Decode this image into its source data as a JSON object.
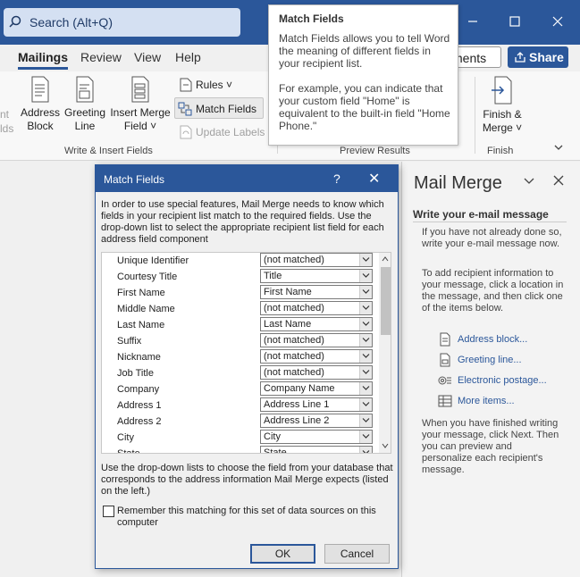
{
  "titlebar": {
    "search_placeholder": "Search (Alt+Q)",
    "minimize": "minimize",
    "maximize": "maximize",
    "close": "close"
  },
  "tabs": [
    {
      "label": "Mailings",
      "active": true
    },
    {
      "label": "Review"
    },
    {
      "label": "View"
    },
    {
      "label": "Help"
    }
  ],
  "header_buttons": {
    "comments": "ments",
    "share": "Share"
  },
  "ribbon": {
    "cut_left_1": "nt",
    "cut_left_2": "lds",
    "address_block": [
      "Address",
      "Block"
    ],
    "greeting_line": [
      "Greeting",
      "Line"
    ],
    "insert_merge_field": [
      "Insert Merge",
      "Field ˅"
    ],
    "rules": "Rules ˅",
    "match_fields": "Match Fields",
    "update_labels": "Update Labels",
    "finish_merge": [
      "Finish &",
      "Merge ˅"
    ],
    "group_write_insert": "Write & Insert Fields",
    "group_preview": "Preview Results",
    "group_finish": "Finish"
  },
  "tooltip": {
    "title": "Match Fields",
    "body1": "Match Fields allows you to tell Word the meaning of different fields in your recipient list.",
    "body2": "For example, you can indicate that your custom field \"Home\" is equivalent to the built-in field \"Home Phone.\""
  },
  "dialog": {
    "title": "Match Fields",
    "help": "?",
    "close": "✕",
    "intro": "In order to use special features, Mail Merge needs to know which fields in your recipient list match to the required fields. Use the drop-down list to select the appropriate recipient list field for each address field component",
    "fields": [
      {
        "label": "Unique Identifier",
        "value": "(not matched)"
      },
      {
        "label": "Courtesy Title",
        "value": "Title"
      },
      {
        "label": "First Name",
        "value": "First Name"
      },
      {
        "label": "Middle Name",
        "value": "(not matched)"
      },
      {
        "label": "Last Name",
        "value": "Last Name"
      },
      {
        "label": "Suffix",
        "value": "(not matched)"
      },
      {
        "label": "Nickname",
        "value": "(not matched)"
      },
      {
        "label": "Job Title",
        "value": "(not matched)"
      },
      {
        "label": "Company",
        "value": "Company Name"
      },
      {
        "label": "Address 1",
        "value": "Address Line 1"
      },
      {
        "label": "Address 2",
        "value": "Address Line 2"
      },
      {
        "label": "City",
        "value": "City"
      },
      {
        "label": "State",
        "value": "State"
      }
    ],
    "note": "Use the drop-down lists to choose the field from your database that corresponds to the address information Mail Merge expects (listed on the left.)",
    "remember_label": "Remember this matching for this set of data sources on this computer",
    "remember_checked": false,
    "ok": "OK",
    "cancel": "Cancel"
  },
  "pane": {
    "title": "Mail Merge",
    "subtitle": "Write your e-mail message",
    "para1": "If you have not already done so, write your e-mail message now.",
    "para2": "To add recipient information to your message, click a location in the message, and then click one of the items below.",
    "links": [
      "Address block...",
      "Greeting line...",
      "Electronic postage...",
      "More items..."
    ],
    "para3": "When you have finished writing your message, click Next. Then you can preview and personalize each recipient's message."
  },
  "colors": {
    "accent": "#2b579a",
    "link": "#2b579a"
  }
}
